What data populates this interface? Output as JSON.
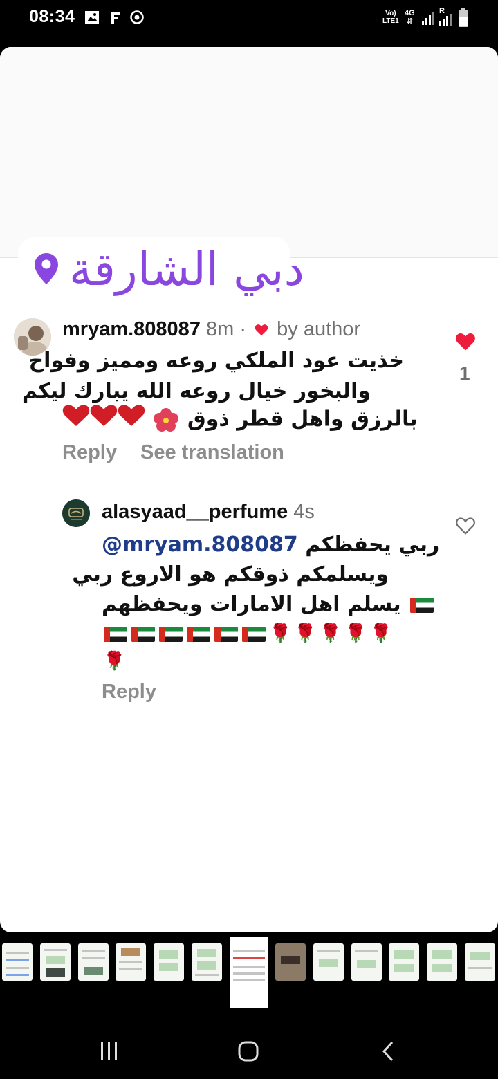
{
  "status_bar": {
    "time": "08:34",
    "network_label_1": "Vo)",
    "network_label_2": "LTE1",
    "network_type": "4G",
    "roaming": "R",
    "icons": [
      "gallery-icon",
      "f-notification-icon",
      "sync-icon",
      "signal-icon",
      "battery-icon"
    ]
  },
  "location_sticker": {
    "text": "دبي الشارقة",
    "icon": "location-pin-icon",
    "color": "#8a47e0"
  },
  "comments": [
    {
      "username": "mryam.808087",
      "time": "8m",
      "separator": "·",
      "liked_by_author_label": "by author",
      "lines": [
        "خذيت عود الملكي روعه ومميز وفواح",
        "والبخور خيال روعه الله يبارك ليكم",
        "بالرزق واهل قطر ذوق"
      ],
      "emojis_line3": [
        "hibiscus",
        "red-heart",
        "red-heart",
        "red-heart"
      ],
      "like_count": "1",
      "liked": true,
      "actions": {
        "reply": "Reply",
        "translate": "See translation"
      }
    },
    {
      "username": "alasyaad__perfume",
      "time": "4s",
      "mention": "@mryam.808087",
      "lines": [
        "ربي يحفظكم",
        "ويسلمكم ذوقكم هو الاروع ربي",
        "يسلم اهل الامارات ويحفظهم"
      ],
      "emojis_line4": [
        "rose",
        "rose",
        "rose",
        "rose",
        "rose",
        "uae-flag",
        "uae-flag",
        "uae-flag",
        "uae-flag",
        "uae-flag",
        "uae-flag"
      ],
      "emojis_line5": [
        "rose"
      ],
      "liked": false,
      "actions": {
        "reply": "Reply"
      }
    }
  ],
  "colors": {
    "accent_heart": "#ed1c3c",
    "mention": "#1f3c88",
    "muted": "#8d8d8d"
  }
}
